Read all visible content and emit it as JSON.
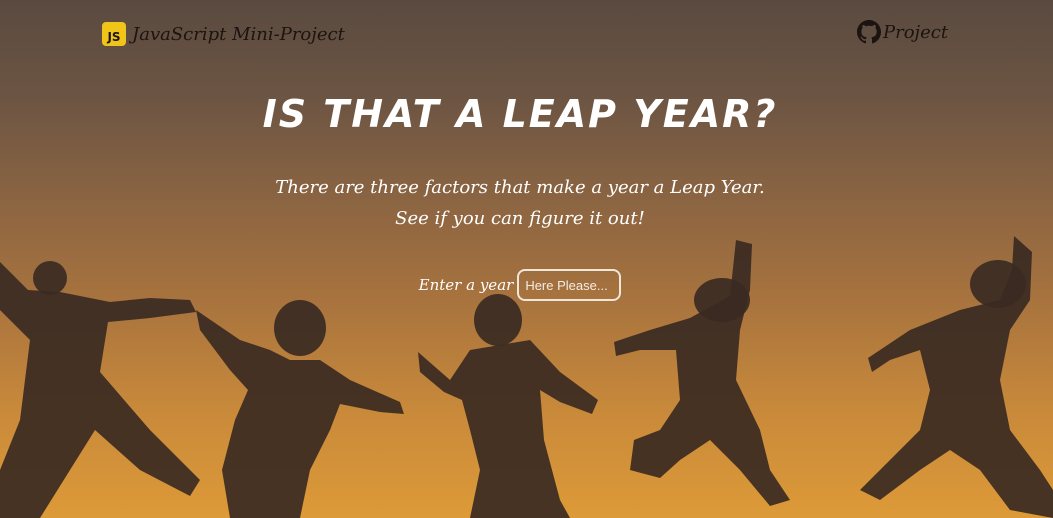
{
  "header": {
    "brand": {
      "badge": "JS",
      "text": "JavaScript Mini-Project"
    },
    "repo": {
      "icon": "github-icon",
      "label": "Project"
    }
  },
  "main": {
    "title": "IS THAT A LEAP YEAR?",
    "subtitle_line1": "There are three factors that make a year a Leap Year.",
    "subtitle_line2": "See if you can figure it out!",
    "form": {
      "label": "Enter a year",
      "input_placeholder": "Here Please...",
      "input_value": ""
    }
  },
  "colors": {
    "js_badge": "#f0c419",
    "text_light": "#ffffff",
    "text_dark": "#1c1410",
    "sky_top": "#5a4a40",
    "sky_bottom": "#dd9a38",
    "silhouette": "#3a2a22"
  }
}
